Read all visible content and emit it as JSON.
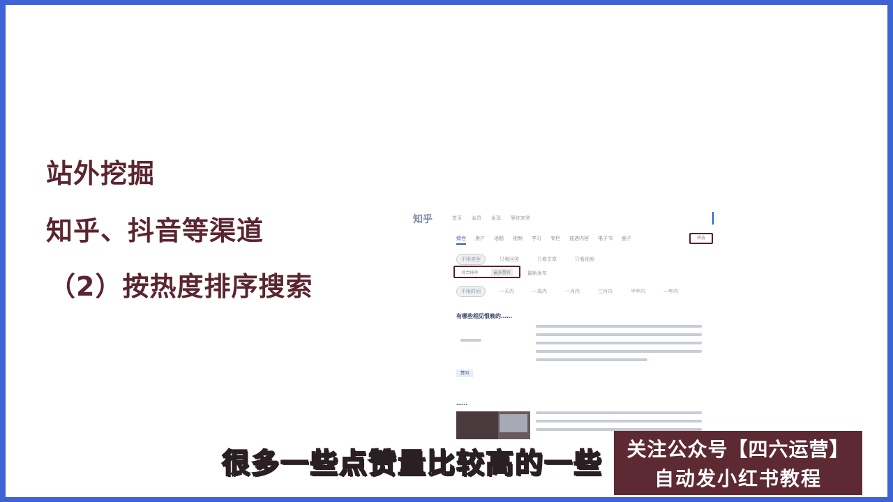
{
  "slide": {
    "heading": "站外挖掘",
    "line2": "知乎、抖音等渠道",
    "line3": "（2）按热度排序搜索"
  },
  "screenshot": {
    "logo": "知乎",
    "top_nav": [
      "首页",
      "会员",
      "发现",
      "等你来答"
    ],
    "tabs": [
      "综合",
      "用户",
      "话题",
      "视频",
      "学习",
      "专栏",
      "盐选内容",
      "电子书",
      "圈子"
    ],
    "filter_label": "筛选",
    "chip_row1": [
      "不限类型",
      "只看回答",
      "只看文章",
      "只看视频"
    ],
    "sort_options": [
      "综合排序",
      "最多赞同",
      "最新发布"
    ],
    "chip_row3": [
      "不限时间",
      "一天内",
      "一周内",
      "一月内",
      "三月内",
      "半年内",
      "一年内"
    ],
    "result1_title": "有哪些相见恨晚的……",
    "result1_vote": "赞同",
    "result2_title": "……"
  },
  "subtitle": "很多一些点赞量比较高的一些",
  "promo": {
    "line1": "关注公众号【四六运营】",
    "line2": "自动发小红书教程"
  }
}
